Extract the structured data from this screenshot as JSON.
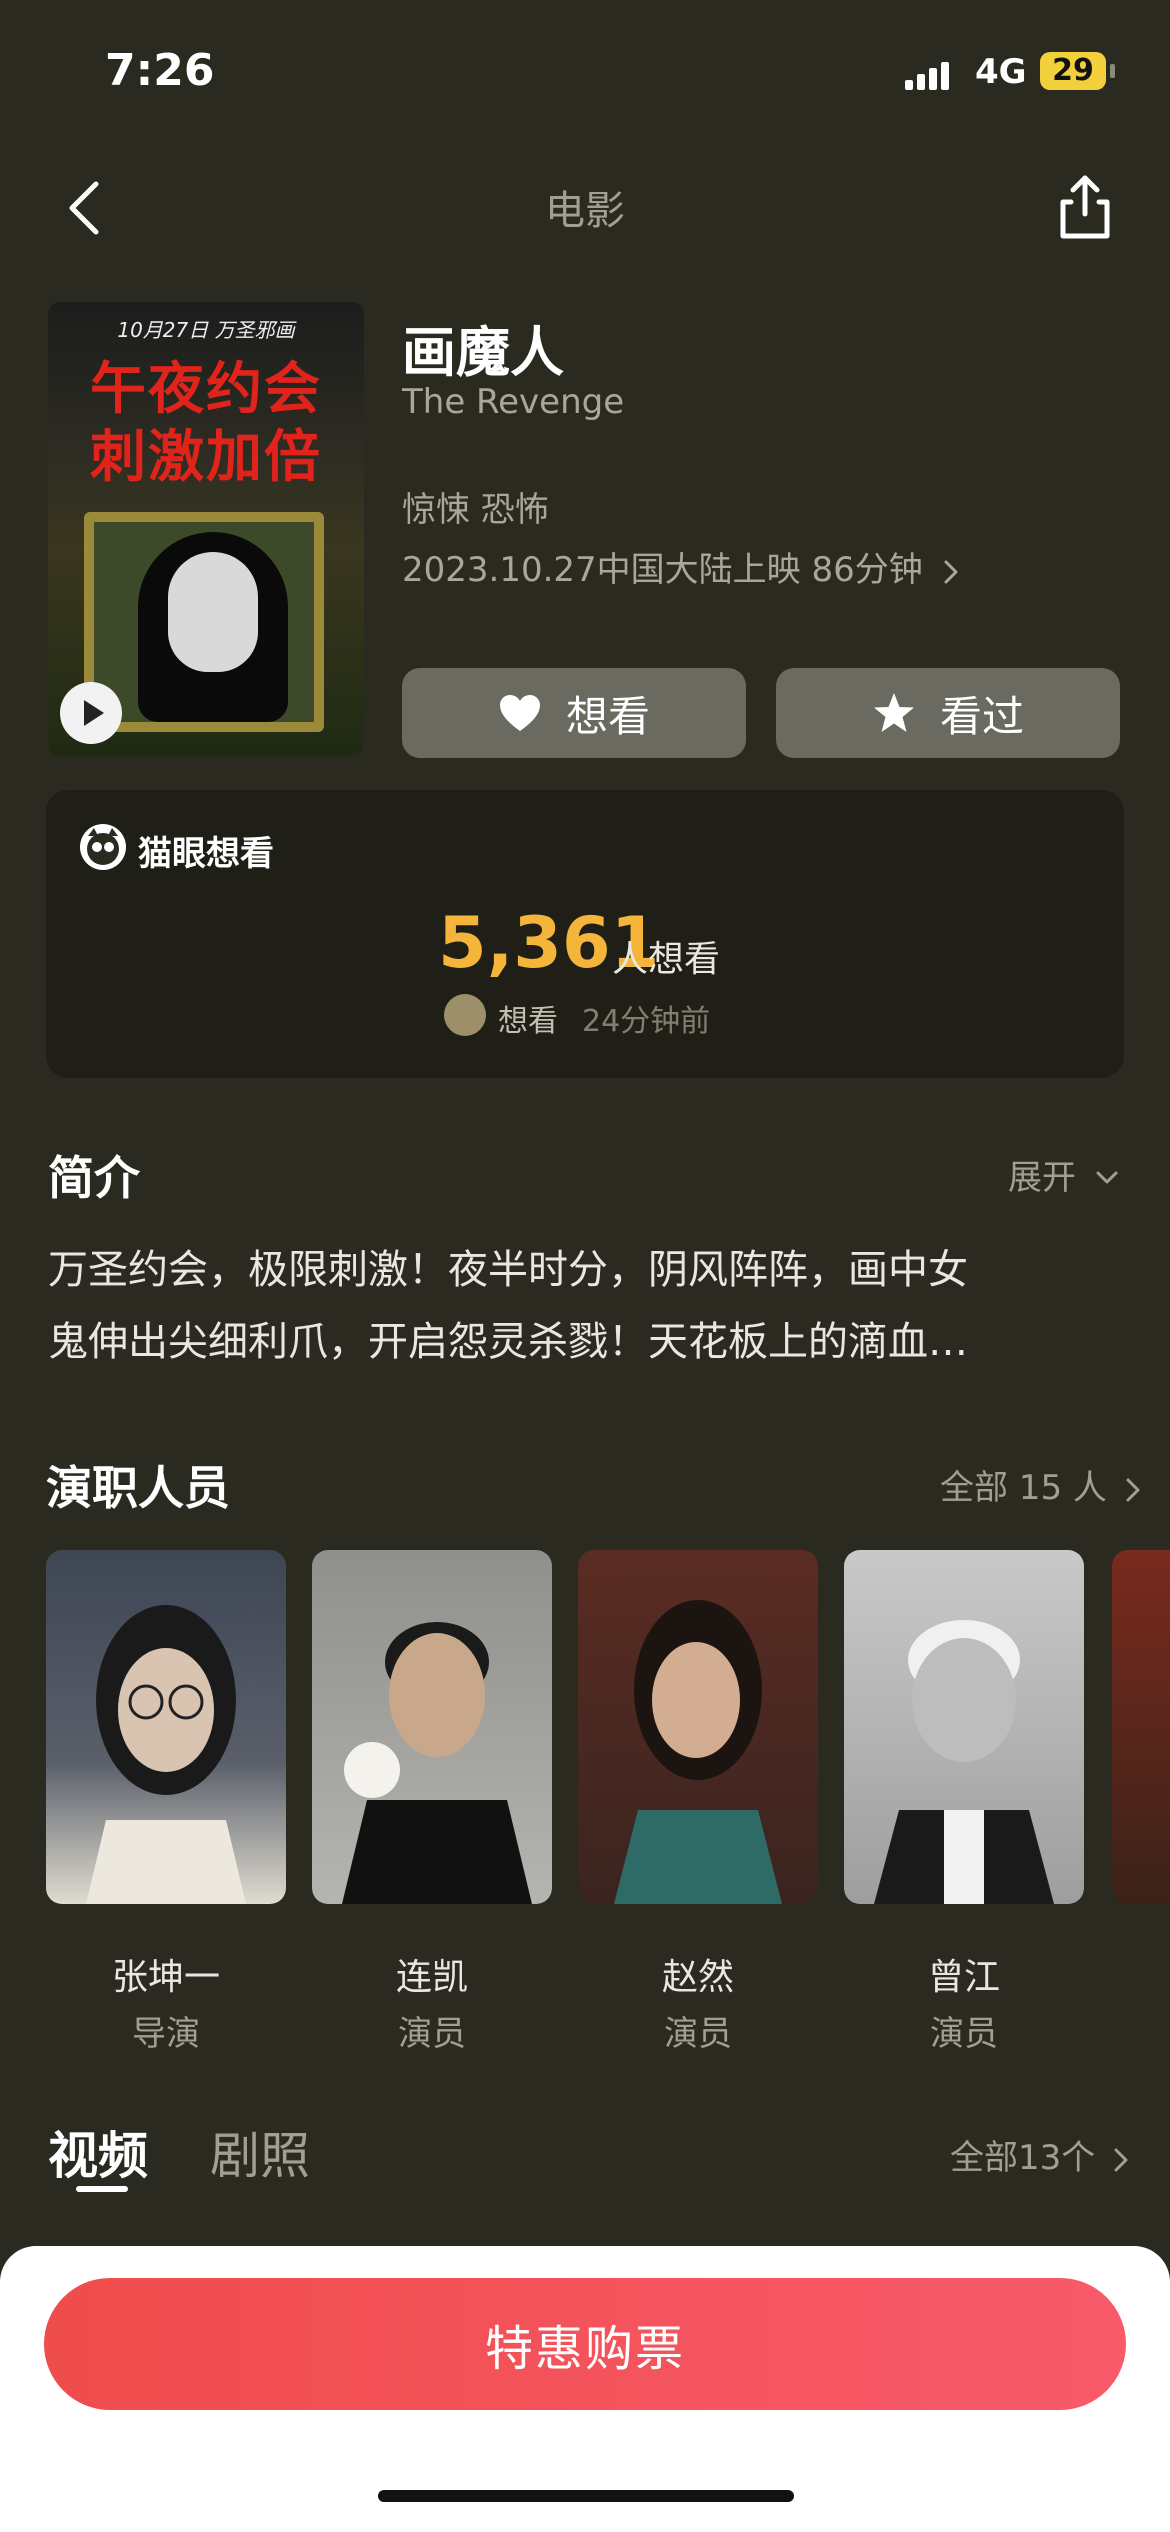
{
  "status": {
    "time": "7:26",
    "network": "4G",
    "battery": "29"
  },
  "nav": {
    "title": "电影"
  },
  "poster": {
    "top_text": "10月27日 万圣邪画",
    "headline_1": "午夜约会",
    "headline_2": "刺激加倍"
  },
  "movie": {
    "title": "画魔人",
    "english_title": "The Revenge",
    "genres": "惊悚 恐怖",
    "release": "2023.10.27中国大陆上映 86分钟"
  },
  "actions": {
    "want": "想看",
    "seen": "看过"
  },
  "want_card": {
    "label": "猫眼想看",
    "count": "5,361",
    "unit": "人想看",
    "recent_action": "想看",
    "recent_time": "24分钟前"
  },
  "intro": {
    "title": "简介",
    "expand": "展开",
    "line1": "万圣约会，极限刺激！夜半时分，阴风阵阵，画中女",
    "line2": "鬼伸出尖细利爪，开启怨灵杀戮！天花板上的滴血…"
  },
  "cast": {
    "title": "演职人员",
    "all": "全部 15 人",
    "members": [
      {
        "name": "张坤一",
        "role": "导演"
      },
      {
        "name": "连凯",
        "role": "演员"
      },
      {
        "name": "赵然",
        "role": "演员"
      },
      {
        "name": "曾江",
        "role": "演员"
      }
    ]
  },
  "media": {
    "tab_video": "视频",
    "tab_photos": "剧照",
    "all": "全部13个"
  },
  "bottom": {
    "buy": "特惠购票"
  },
  "colors": {
    "background": "#2a2a20",
    "accent": "#f5b53a",
    "buy_button": "#f25560"
  }
}
